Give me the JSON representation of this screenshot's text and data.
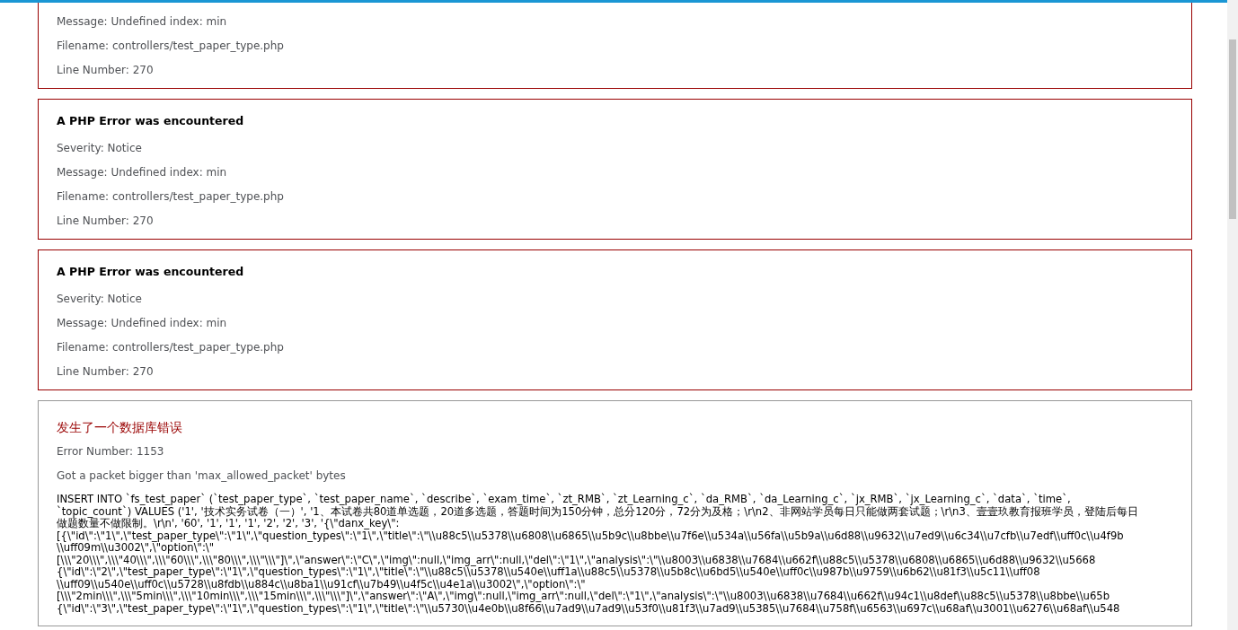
{
  "php_errors": [
    {
      "cut_top": true,
      "lines": [
        "Message: Undefined index: min",
        "Filename: controllers/test_paper_type.php",
        "Line Number: 270"
      ]
    },
    {
      "cut_top": false,
      "heading": "A PHP Error was encountered",
      "lines": [
        "Severity: Notice",
        "Message: Undefined index: min",
        "Filename: controllers/test_paper_type.php",
        "Line Number: 270"
      ]
    },
    {
      "cut_top": false,
      "heading": "A PHP Error was encountered",
      "lines": [
        "Severity: Notice",
        "Message: Undefined index: min",
        "Filename: controllers/test_paper_type.php",
        "Line Number: 270"
      ]
    }
  ],
  "database_error": {
    "heading": "发生了一个数据库错误",
    "lines": [
      "Error Number: 1153",
      "Got a packet bigger than 'max_allowed_packet' bytes"
    ],
    "query_lines": [
      "INSERT INTO `fs_test_paper` (`test_paper_type`, `test_paper_name`, `describe`, `exam_time`, `zt_RMB`, `zt_Learning_c`, `da_RMB`, `da_Learning_c`, `jx_RMB`, `jx_Learning_c`, `data`, `time`,",
      "`topic_count`) VALUES ('1', '技术实务试卷（一）', '1、本试卷共80道单选题，20道多选题，答题时间为150分钟，总分120分，72分为及格；\\r\\n2、非网站学员每日只能做两套试题；\\r\\n3、壹壹玖教育报班学员，登陆后每日",
      "做题数量不做限制。\\r\\n', '60', '1', '1', '1', '2', '2', '3', '{\\\"danx_key\\\":",
      "[{\\\"id\\\":\\\"1\\\",\\\"test_paper_type\\\":\\\"1\\\",\\\"question_types\\\":\\\"1\\\",\\\"title\\\":\\\"\\\\u88c5\\\\u5378\\\\u6808\\\\u6865\\\\u5b9c\\\\u8bbe\\\\u7f6e\\\\u534a\\\\u56fa\\\\u5b9a\\\\u6d88\\\\u9632\\\\u7ed9\\\\u6c34\\\\u7cfb\\\\u7edf\\\\uff0c\\\\u4f9b",
      "\\\\uff09m\\\\u3002\\\",\\\"option\\\":\\\"",
      "[\\\\\\\"20\\\\\\\",\\\\\\\"40\\\\\\\",\\\\\\\"60\\\\\\\",\\\\\\\"80\\\\\\\",\\\\\\\"\\\\\\\"]\\\",\\\"answer\\\":\\\"C\\\",\\\"img\\\":null,\\\"img_arr\\\":null,\\\"del\\\":\\\"1\\\",\\\"analysis\\\":\\\"\\\\u8003\\\\u6838\\\\u7684\\\\u662f\\\\u88c5\\\\u5378\\\\u6808\\\\u6865\\\\u6d88\\\\u9632\\\\u5668",
      "{\\\"id\\\":\\\"2\\\",\\\"test_paper_type\\\":\\\"1\\\",\\\"question_types\\\":\\\"1\\\",\\\"title\\\":\\\"\\\\u88c5\\\\u5378\\\\u540e\\\\uff1a\\\\u88c5\\\\u5378\\\\u5b8c\\\\u6bd5\\\\u540e\\\\uff0c\\\\u987b\\\\u9759\\\\u6b62\\\\u81f3\\\\u5c11\\\\uff08",
      "\\\\uff09\\\\u540e\\\\uff0c\\\\u5728\\\\u8fdb\\\\u884c\\\\u8ba1\\\\u91cf\\\\u7b49\\\\u4f5c\\\\u4e1a\\\\u3002\\\",\\\"option\\\":\\\"",
      "[\\\\\\\"2min\\\\\\\",\\\\\\\"5min\\\\\\\",\\\\\\\"10min\\\\\\\",\\\\\\\"15min\\\\\\\",\\\\\\\"\\\\\\\"]\\\",\\\"answer\\\":\\\"A\\\",\\\"img\\\":null,\\\"img_arr\\\":null,\\\"del\\\":\\\"1\\\",\\\"analysis\\\":\\\"\\\\u8003\\\\u6838\\\\u7684\\\\u662f\\\\u94c1\\\\u8def\\\\u88c5\\\\u5378\\\\u8bbe\\\\u65b",
      "{\\\"id\\\":\\\"3\\\",\\\"test_paper_type\\\":\\\"1\\\",\\\"question_types\\\":\\\"1\\\",\\\"title\\\":\\\"\\\\u5730\\\\u4e0b\\\\u8f66\\\\u7ad9\\\\u7ad9\\\\u53f0\\\\u81f3\\\\u7ad9\\\\u5385\\\\u7684\\\\u758f\\\\u6563\\\\u697c\\\\u68af\\\\u3001\\\\u6276\\\\u68af\\\\u548"
    ]
  }
}
